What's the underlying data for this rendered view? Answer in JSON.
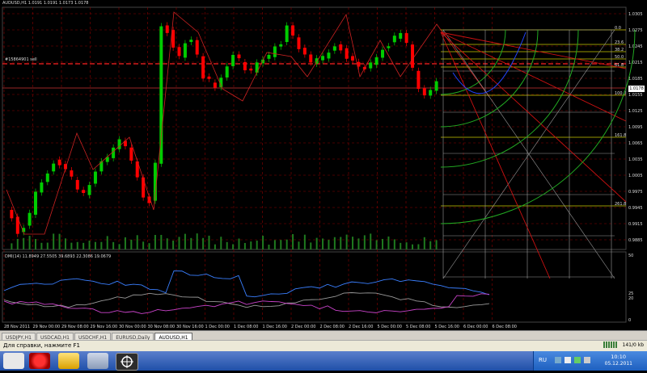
{
  "chart": {
    "title": "AUDUSD,H1  1.0191 1.0191 1.0173 1.0178",
    "sell_label": "#15864901 sell",
    "current_price": "1.0178",
    "price_ticks": [
      "1.0305",
      "1.0275",
      "1.0245",
      "1.0215",
      "1.0185",
      "1.0155",
      "1.0125",
      "1.0095",
      "1.0065",
      "1.0035",
      "1.0005",
      "0.9975",
      "0.9945",
      "0.9915",
      "0.9885"
    ],
    "fib_levels": [
      "0.0",
      "23.6",
      "38.2",
      "50.0",
      "61.8",
      "100.0",
      "161.8",
      "261.8"
    ],
    "indicator_title": "DMI(14) 11.8949 27.5505 39.6893 22.3086 19.0679",
    "indicator_ticks": [
      "50",
      "25",
      "20",
      "0"
    ],
    "time_ticks": [
      "28 Nov 2011",
      "29 Nov 00:00",
      "29 Nov 08:00",
      "29 Nov 16:00",
      "30 Nov 00:00",
      "30 Nov 08:00",
      "30 Nov 16:00",
      "1 Dec 00:00",
      "1 Dec 08:00",
      "1 Dec 16:00",
      "2 Dec 00:00",
      "2 Dec 08:00",
      "2 Dec 16:00",
      "5 Dec 00:00",
      "5 Dec 08:00",
      "5 Dec 16:00",
      "6 Dec 00:00",
      "6 Dec 08:00"
    ]
  },
  "tabs": [
    {
      "label": "USDJPY,H1",
      "active": false
    },
    {
      "label": "USDCAD,H1",
      "active": false
    },
    {
      "label": "USDCHF,H1",
      "active": false
    },
    {
      "label": "EURUSD,Daily",
      "active": false
    },
    {
      "label": "AUDUSD,H1",
      "active": true
    }
  ],
  "status": {
    "help": "Для справки, нажмите F1",
    "traffic": "141/0 kb"
  },
  "taskbar": {
    "lang": "RU",
    "time": "10:10",
    "date": "05.12.2011"
  },
  "colors": {
    "bull": "#00cc00",
    "bear": "#ff0000",
    "grid": "#8b0000",
    "fib": "#c8c800",
    "gann": "#9a9a9a"
  }
}
